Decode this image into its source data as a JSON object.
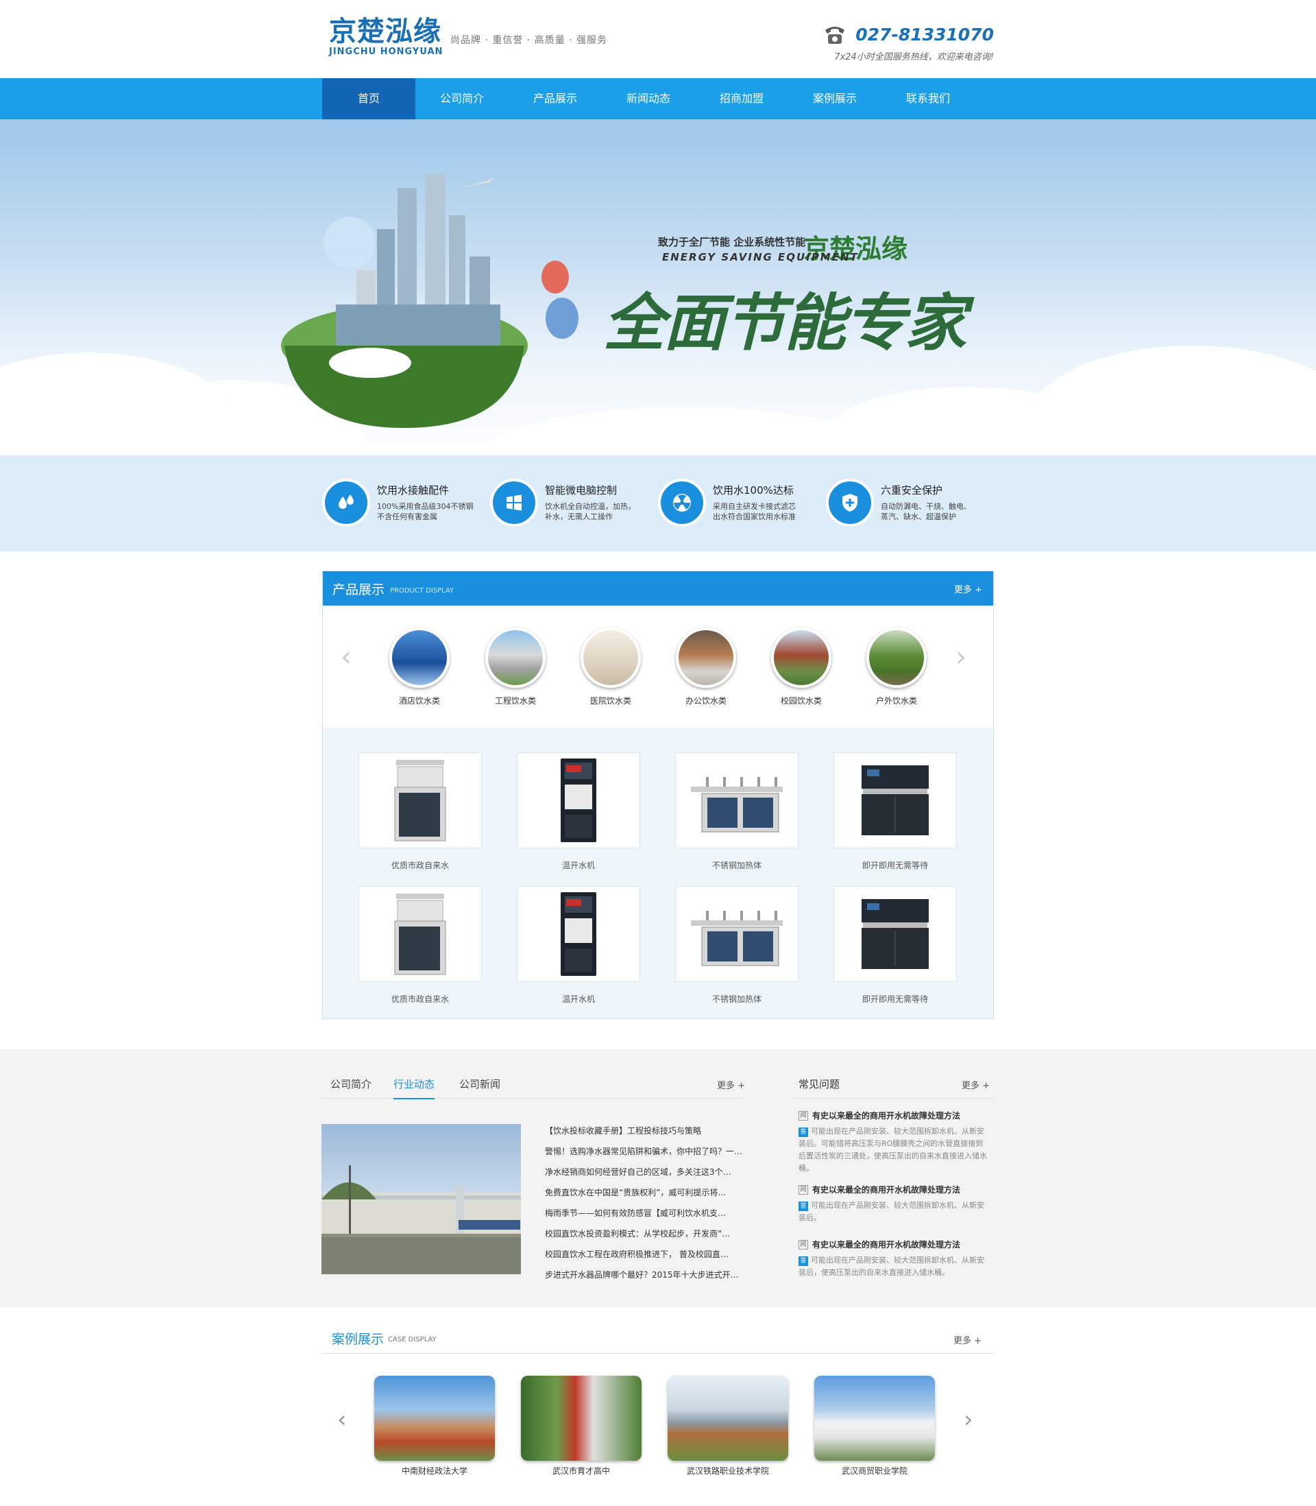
{
  "header": {
    "logo_cn": "京楚泓缘",
    "logo_en": "JINGCHU HONGYUAN",
    "slogan": "尚品牌 · 重信誉 · 高质量 · 强服务",
    "phone": "027-81331070",
    "phone_sub": "7x24小时全国服务热线，欢迎来电咨询!"
  },
  "nav": {
    "items": [
      "首页",
      "公司简介",
      "产品展示",
      "新闻动态",
      "招商加盟",
      "案例展示",
      "联系我们"
    ]
  },
  "banner": {
    "line1": "致力于全厂节能 企业系统性节能",
    "brand": "京楚泓缘",
    "en": "ENERGY SAVING EQUIPMENT",
    "big": "全面节能专家"
  },
  "features": [
    {
      "title": "饮用水接触配件",
      "desc1": "100%采用食品级304不锈钢",
      "desc2": "不含任何有害金属",
      "icon": "water-drops-icon"
    },
    {
      "title": "智能微电脑控制",
      "desc1": "饮水机全自动控温，加热，",
      "desc2": "补水，无需人工操作",
      "icon": "windows-icon"
    },
    {
      "title": "饮用水100%达标",
      "desc1": "采用自主研发卡接式滤芯",
      "desc2": "出水符合国家饮用水标准",
      "icon": "radiation-icon"
    },
    {
      "title": "六重安全保护",
      "desc1": "自动防漏电、干烧、触电、",
      "desc2": "蒸汽、缺水、超温保护",
      "icon": "shield-icon"
    }
  ],
  "products": {
    "title": "产品展示",
    "subtitle": "PRODUCT DISPLAY",
    "more": "更多 +",
    "categories": [
      "酒店饮水类",
      "工程饮水类",
      "医院饮水类",
      "办公饮水类",
      "校园饮水类",
      "户外饮水类"
    ],
    "items": [
      "优质市政自来水",
      "温开水机",
      "不锈钢加热体",
      "即开即用无需等待",
      "优质市政自来水",
      "温开水机",
      "不锈钢加热体",
      "即开即用无需等待"
    ]
  },
  "news": {
    "tabs": [
      "公司简介",
      "行业动态",
      "公司新闻"
    ],
    "more": "更多 +",
    "list": [
      "【饮水投标收藏手册】工程投标技巧与策略",
      "警惕！选购净水器常见陷阱和骗术，你中招了吗？一…",
      "净水经销商如何经营好自己的区域，多关注这3个…",
      "免费直饮水在中国是“贵族权利”，威可利提示将…",
      "梅雨季节——如何有效防感冒【威可利饮水机支…",
      "校园直饮水投资盈利模式：从学校起步，开发商“…",
      "校园直饮水工程在政府积极推进下， 普及校园直…",
      "步进式开水器品牌哪个最好？2015年十大步进式开…"
    ]
  },
  "faq": {
    "title": "常见问题",
    "more": "更多 +",
    "items": [
      {
        "q": "有史以来最全的商用开水机故障处理方法",
        "a": "可能出现在产品刚安装、较大范围拆卸水机、从新安装后。可能错将高压泵与RO膜膜壳之间的水管直接接到后置活性炭的三通处，使高压泵出的自来水直接进入储水桶。"
      },
      {
        "q": "有史以来最全的商用开水机故障处理方法",
        "a": "可能出现在产品刚安装、较大范围拆卸水机、从新安装后。"
      },
      {
        "q": "有史以来最全的商用开水机故障处理方法",
        "a": "可能出现在产品刚安装、较大范围拆卸水机、从新安装后，使高压泵出的自来水直接进入储水桶。"
      }
    ]
  },
  "cases": {
    "title": "案例展示",
    "subtitle": "CASE DISPLAY",
    "more": "更多 +",
    "items": [
      "中南财经政法大学",
      "武汉市育才高中",
      "武汉铁路职业技术学院",
      "武汉商贸职业学院"
    ]
  }
}
